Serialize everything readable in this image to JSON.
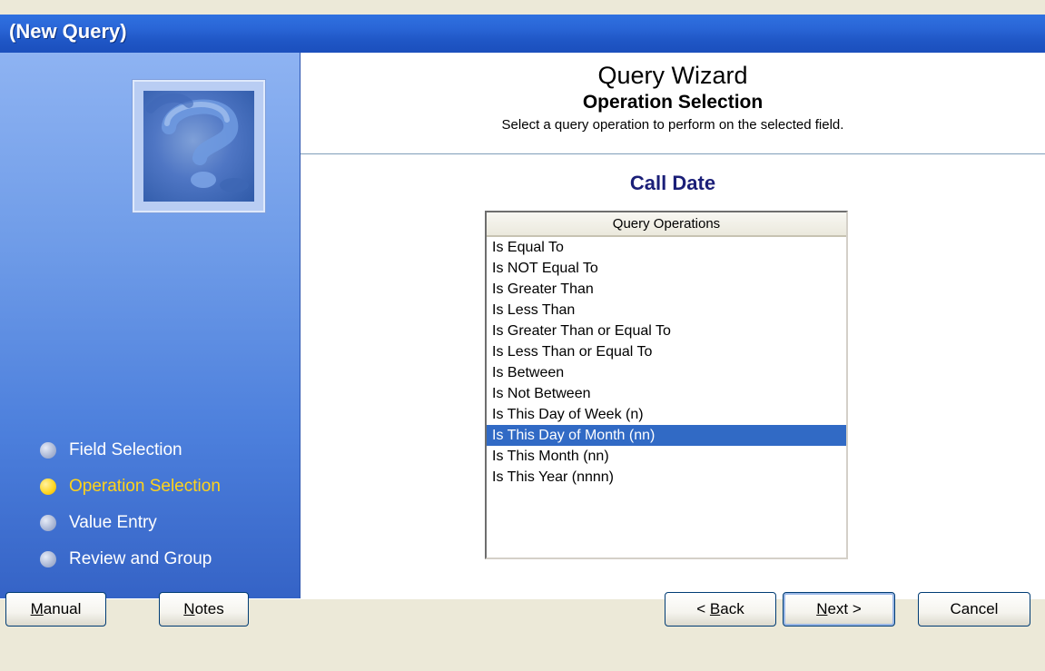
{
  "window": {
    "title": "(New Query)"
  },
  "sidebar": {
    "steps": [
      {
        "label": "Field Selection",
        "active": false
      },
      {
        "label": "Operation Selection",
        "active": true
      },
      {
        "label": "Value Entry",
        "active": false
      },
      {
        "label": "Review and Group",
        "active": false
      }
    ]
  },
  "main": {
    "title": "Query Wizard",
    "subtitle": "Operation Selection",
    "description": "Select a query operation to perform on the selected field.",
    "field_name": "Call Date",
    "list": {
      "header": "Query Operations",
      "selected_index": 9,
      "items": [
        "Is Equal To",
        "Is NOT Equal To",
        "Is Greater Than",
        "Is Less Than",
        "Is Greater Than or Equal To",
        "Is Less Than or Equal To",
        "Is Between",
        "Is Not Between",
        "Is This Day of Week (n)",
        "Is This Day of Month (nn)",
        "Is This Month (nn)",
        "Is This Year (nnnn)"
      ]
    }
  },
  "footer": {
    "manual": {
      "accel": "M",
      "rest": "anual"
    },
    "notes": {
      "accel": "N",
      "rest": "otes"
    },
    "back": {
      "pre": "< ",
      "accel": "B",
      "rest": "ack"
    },
    "next": {
      "accel": "N",
      "rest": "ext >"
    },
    "cancel": "Cancel"
  },
  "colors": {
    "titlebar": "#1f56c5",
    "selection": "#316ac5",
    "active_step": "#ffd31a",
    "field_name": "#1b1f78"
  },
  "icons": [
    "wizard-question-mark-icon",
    "step-bullet-icon"
  ]
}
